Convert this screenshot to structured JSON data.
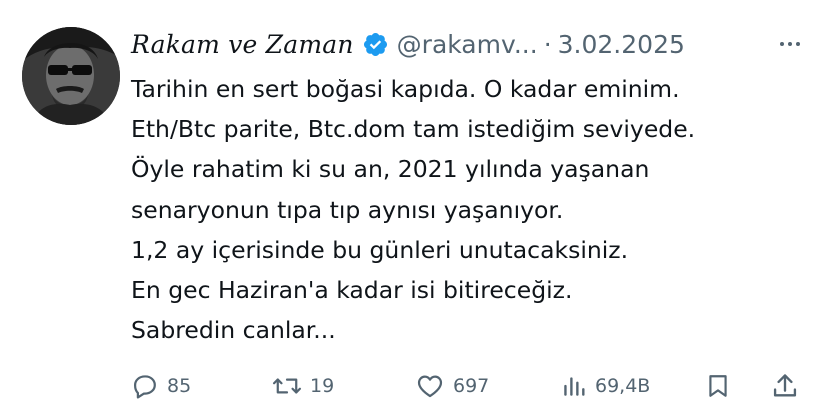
{
  "tweet": {
    "display_name": "Rakam ve Zaman",
    "handle": "@rakamv...",
    "separator": "·",
    "date": "3.02.2025",
    "verified": true,
    "text_lines": [
      "Tarihin en sert boğasi kapıda. O kadar eminim.",
      "Eth/Btc parite, Btc.dom tam istediğim seviyede.",
      "Öyle rahatim ki su an, 2021 yılında yaşanan",
      "senaryonun tıpa tıp aynısı yaşanıyor.",
      "1,2 ay içerisinde bu günleri unutacaksiniz.",
      "En gec Haziran'a kadar isi bitireceğiz.",
      "Sabredin canlar..."
    ],
    "actions": {
      "replies": "85",
      "retweets": "19",
      "likes": "697",
      "views": "69,4B"
    }
  },
  "icons": {
    "avatar": "avatar-photo",
    "verified": "verified-badge-icon",
    "more": "more-options-icon",
    "reply": "reply-icon",
    "retweet": "retweet-icon",
    "like": "heart-icon",
    "views": "views-chart-icon",
    "bookmark": "bookmark-icon",
    "share": "share-icon"
  },
  "colors": {
    "verified_blue": "#1d9bf0",
    "text": "#0f1419",
    "secondary": "#536471"
  }
}
